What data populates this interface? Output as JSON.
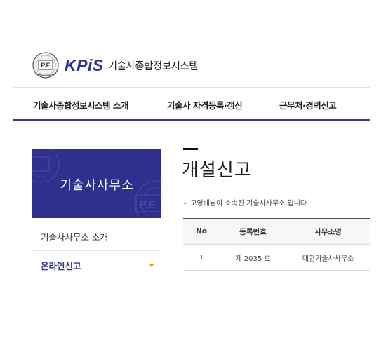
{
  "header": {
    "brand": "KPiS",
    "system_name": "기술사종합정보시스템",
    "emblem_icon": "pe-seal-icon",
    "brand_color": "#2f3191"
  },
  "nav": {
    "items": [
      {
        "label": "기술사종합정보시스템 소개"
      },
      {
        "label": "기술사 자격등록·갱신"
      },
      {
        "label": "근무처·경력신고"
      }
    ]
  },
  "sidebar": {
    "banner_title": "기술사사무소",
    "items": [
      {
        "label": "기술사사무소 소개"
      },
      {
        "label": "온라인신고",
        "icon": "caret-down-icon"
      }
    ],
    "banner_color": "#2e308e",
    "active_color": "#2f3191",
    "caret_color": "#f0a400"
  },
  "main": {
    "title": "개설신고",
    "notice": "고영배님이 소속된 기술사사무소 입니다.",
    "table": {
      "headers": [
        "No",
        "등록번호",
        "사무소명"
      ],
      "rows": [
        [
          "1",
          "제 2035 호",
          "대한기술사사무소"
        ]
      ]
    }
  }
}
